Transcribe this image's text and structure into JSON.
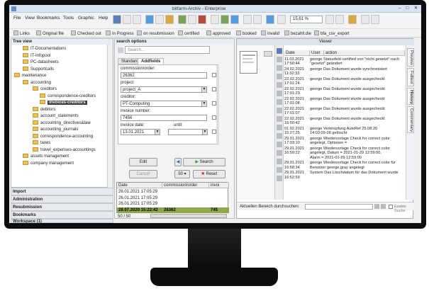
{
  "window": {
    "title": "bitfarm-Archiv - Enterprise"
  },
  "menu": [
    "File",
    "View",
    "Bookmarks",
    "Tools",
    "Graphic",
    "Help"
  ],
  "zoom": "15,61 %",
  "filters": [
    "Links",
    "Original file",
    "Checked out",
    "In Progress",
    "on resubmission",
    "certified",
    "approved",
    "booked",
    "invalid",
    "bezahlt.die",
    "bfa_csv_export"
  ],
  "tree": {
    "header": "Tree view",
    "items": [
      {
        "label": "IT-Documentations",
        "level": 2
      },
      {
        "label": "IT-Infopool",
        "level": 2
      },
      {
        "label": "PC-datasheets",
        "level": 2
      },
      {
        "label": "Supportcalls",
        "level": 2
      },
      {
        "label": "maintenance",
        "level": 1
      },
      {
        "label": "accounting",
        "level": 2
      },
      {
        "label": "creditors",
        "level": 3
      },
      {
        "label": "correspondence-creditors",
        "level": 4
      },
      {
        "label": "invoices-creditors",
        "level": 4,
        "selected": true
      },
      {
        "label": "debitors",
        "level": 3
      },
      {
        "label": "account_statements",
        "level": 3
      },
      {
        "label": "accounting_directives&law",
        "level": 3
      },
      {
        "label": "accounting_journals",
        "level": 3
      },
      {
        "label": "correspondence-accounting",
        "level": 3
      },
      {
        "label": "taxes",
        "level": 3
      },
      {
        "label": "travel_expenses-accountings",
        "level": 3
      },
      {
        "label": "assets management",
        "level": 2
      },
      {
        "label": "company management",
        "level": 2
      }
    ],
    "accordion": [
      "Import",
      "Administration",
      "Resubmission",
      "Bookmarks",
      "Workspace (1)"
    ]
  },
  "search": {
    "header": "search options",
    "placeholder": "Search...",
    "tabs": [
      "Standard",
      "Addfields"
    ],
    "fields": [
      {
        "label": "commission/order:",
        "value": "26362"
      },
      {
        "label": "project:",
        "value": "project_A"
      },
      {
        "label": "creditor:",
        "value": "PT-Computing"
      },
      {
        "label": "invoice number:",
        "value": "7456"
      },
      {
        "label": "invoice date:",
        "value": "13.01.2021",
        "until_label": "until:"
      }
    ],
    "buttons": {
      "edit": "Edit",
      "cancel": "Cancel",
      "search": "Search",
      "reset": "Reset",
      "count": "50"
    },
    "results": {
      "columns": [
        "Date",
        "commission/order",
        "invoi"
      ],
      "rows": [
        [
          "26.01.2021 17:05:29",
          "",
          ""
        ],
        [
          "26.01.2021 17:05:29",
          "",
          ""
        ],
        [
          "26.01.2021 17:05:29",
          "",
          ""
        ],
        [
          "28.07.2020 15:22:42",
          "26362",
          "745"
        ]
      ],
      "pager": "50 / 50"
    }
  },
  "viewer": {
    "header": "Viewer",
    "columns": [
      "Date",
      "User",
      "action"
    ],
    "history": [
      {
        "date": "11.03.2021",
        "time": "17:50:44",
        "action": [
          "george Statusfeld certified von \"nicht gesetzt\" nach",
          "\"gesetzt\" geändert"
        ]
      },
      {
        "date": "24.02.2021",
        "time": "11:32:33",
        "action": [
          "george Das Dokument wurde synchronisiert"
        ]
      },
      {
        "date": "22.02.2021",
        "time": "17:01:24",
        "action": [
          "george Das Dokument wurde ausgecheckt"
        ]
      },
      {
        "date": "22.02.2021",
        "time": "17:01:23",
        "action": [
          "george Das Dokument wurde ausgecheckt"
        ]
      },
      {
        "date": "22.02.2021",
        "time": "17:01:08",
        "action": [
          "george Das Dokument wurde ausgecheckt"
        ]
      },
      {
        "date": "22.02.2021",
        "time": "17:01:07",
        "action": [
          "george Das Dokument wurde ausgecheckt"
        ]
      },
      {
        "date": "22.02.2021",
        "time": "16:50:42",
        "action": [
          "george Das Dokument wurde ausgecheckt"
        ]
      },
      {
        "date": "01.02.2021",
        "time": "15:27:25",
        "action": [
          "george Verknüpfung AutoRef 25.08.20",
          "14:03:09-28 gelöscht"
        ]
      },
      {
        "date": "29.01.2021",
        "time": "17:03:10",
        "action": [
          "george Wiedervorlage Check for correct color",
          "angelegt, Optionen ="
        ]
      },
      {
        "date": "29.01.2021",
        "time": "16:59:22",
        "action": [
          "george Wiedervorlage Check for correct color",
          "angelegt, Datum = 2021-01-29 12:59:00,",
          "Alarm = 2021-01-29 12:59:00"
        ]
      },
      {
        "date": "29.01.2021",
        "time": "16:58:34",
        "action": [
          "george Wiedervorlage Check for correct color für",
          "Benutzer george.gray angelegt"
        ]
      },
      {
        "date": "29.01.2021",
        "time": "16:52:59",
        "action": [
          "System Das Löschdatum für das Dokument wurde"
        ]
      }
    ],
    "side_tabs": [
      "Preview",
      "Fulltext",
      "History",
      "Commentary"
    ],
    "fulltext_label": "Aktuellen Bereich durchsuchen:",
    "exact_label": "Exakte Suche"
  }
}
